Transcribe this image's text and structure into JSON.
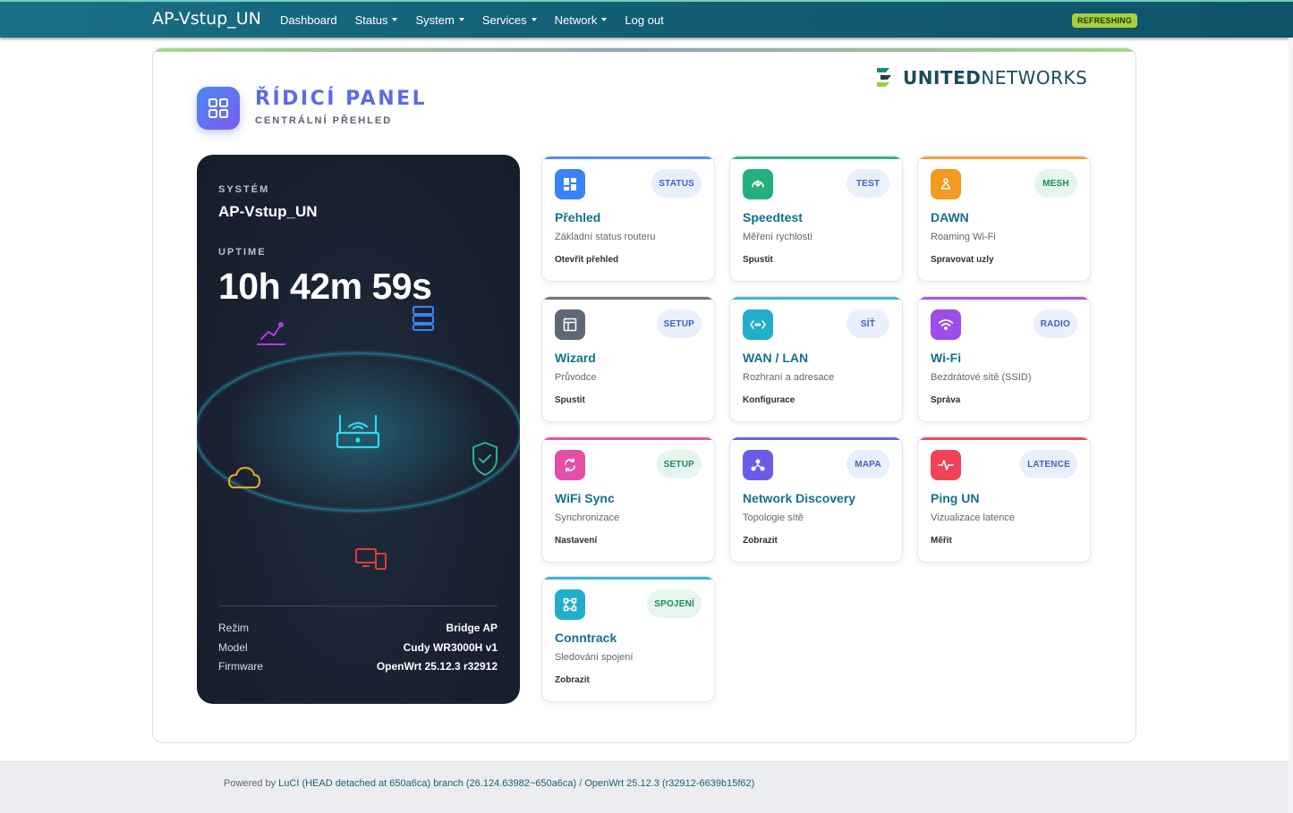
{
  "topbar": {
    "brand": "AP-Vstup_UN",
    "nav": [
      {
        "label": "Dashboard",
        "dropdown": false
      },
      {
        "label": "Status",
        "dropdown": true
      },
      {
        "label": "System",
        "dropdown": true
      },
      {
        "label": "Services",
        "dropdown": true
      },
      {
        "label": "Network",
        "dropdown": true
      },
      {
        "label": "Log out",
        "dropdown": false
      }
    ],
    "status_badge": "REFRESHING"
  },
  "logo": {
    "bold": "UNITED",
    "light": "NETWORKS"
  },
  "header": {
    "title": "ŘÍDICÍ PANEL",
    "subtitle": "CENTRÁLNÍ PŘEHLED"
  },
  "system": {
    "label": "SYSTÉM",
    "hostname": "AP-Vstup_UN",
    "uptime_label": "UPTIME",
    "uptime": "10h 42m 59s",
    "rows": [
      {
        "key": "Režim",
        "value": "Bridge AP"
      },
      {
        "key": "Model",
        "value": "Cudy WR3000H v1"
      },
      {
        "key": "Firmware",
        "value": "OpenWrt 25.12.3 r32912"
      }
    ]
  },
  "tiles": [
    {
      "name": "prehled",
      "icon": "dashboard-icon",
      "badge": "STATUS",
      "title": "Přehled",
      "desc": "Základní status routeru",
      "action": "Otevřít přehled",
      "bar": "#5b8def",
      "icon_bg": "#3b82f6",
      "badge_bg": "#e9effc",
      "badge_fg": "#3f63c4"
    },
    {
      "name": "speedtest",
      "icon": "speedtest-icon",
      "badge": "TEST",
      "title": "Speedtest",
      "desc": "Měření rychlosti",
      "action": "Spustit",
      "bar": "#3db389",
      "icon_bg": "#22b07d",
      "badge_bg": "#e9effc",
      "badge_fg": "#3f63c4"
    },
    {
      "name": "dawn",
      "icon": "mesh-icon",
      "badge": "MESH",
      "title": "DAWN",
      "desc": "Roaming Wi-Fi",
      "action": "Spravovat uzly",
      "bar": "#f0a040",
      "icon_bg": "#f29a24",
      "badge_bg": "#e6f6ee",
      "badge_fg": "#1d8a5a"
    },
    {
      "name": "wizard",
      "icon": "layout-icon",
      "badge": "SETUP",
      "title": "Wizard",
      "desc": "Průvodce",
      "action": "Spustit",
      "bar": "#6b7585",
      "icon_bg": "#5f6877",
      "badge_bg": "#e9effc",
      "badge_fg": "#3f63c4"
    },
    {
      "name": "wanlan",
      "icon": "network-code-icon",
      "badge": "SÍŤ",
      "title": "WAN / LAN",
      "desc": "Rozhraní a adresace",
      "action": "Konfigurace",
      "bar": "#3fb6cf",
      "icon_bg": "#22aecb",
      "badge_bg": "#e9effc",
      "badge_fg": "#3f63c4"
    },
    {
      "name": "wifi",
      "icon": "wifi-icon",
      "badge": "RADIO",
      "title": "Wi-Fi",
      "desc": "Bezdrátové sítě (SSID)",
      "action": "Správa",
      "bar": "#a35ae8",
      "icon_bg": "#9b4fe6",
      "badge_bg": "#e9effc",
      "badge_fg": "#3f63c4"
    },
    {
      "name": "wifisync",
      "icon": "sync-icon",
      "badge": "SETUP",
      "title": "WiFi Sync",
      "desc": "Synchronizace",
      "action": "Nastavení",
      "bar": "#e858a8",
      "icon_bg": "#e24fa6",
      "badge_bg": "#e6f6ee",
      "badge_fg": "#1d8a5a"
    },
    {
      "name": "discovery",
      "icon": "topology-icon",
      "badge": "MAPA",
      "title": "Network Discovery",
      "desc": "Topologie sítě",
      "action": "Zobrazit",
      "bar": "#6a66e6",
      "icon_bg": "#6a5ce8",
      "badge_bg": "#e9effc",
      "badge_fg": "#3f63c4"
    },
    {
      "name": "pingun",
      "icon": "pulse-icon",
      "badge": "LATENCE",
      "title": "Ping UN",
      "desc": "Vizualizace latence",
      "action": "Měřit",
      "bar": "#ec4b62",
      "icon_bg": "#ef4458",
      "badge_bg": "#e9effc",
      "badge_fg": "#3f63c4"
    },
    {
      "name": "conntrack",
      "icon": "connections-icon",
      "badge": "SPOJENÍ",
      "title": "Conntrack",
      "desc": "Sledování spojení",
      "action": "Zobrazit",
      "bar": "#3fb6cf",
      "icon_bg": "#22aecb",
      "badge_bg": "#e6f6ee",
      "badge_fg": "#1d8a5a"
    }
  ],
  "footer": {
    "powered": "Powered by ",
    "luci": "LuCI (HEAD detached at 650a6ca) branch (26.124.63982~650a6ca)",
    "sep": " / ",
    "openwrt": "OpenWrt 25.12.3 (r32912-6639b15f62)"
  }
}
